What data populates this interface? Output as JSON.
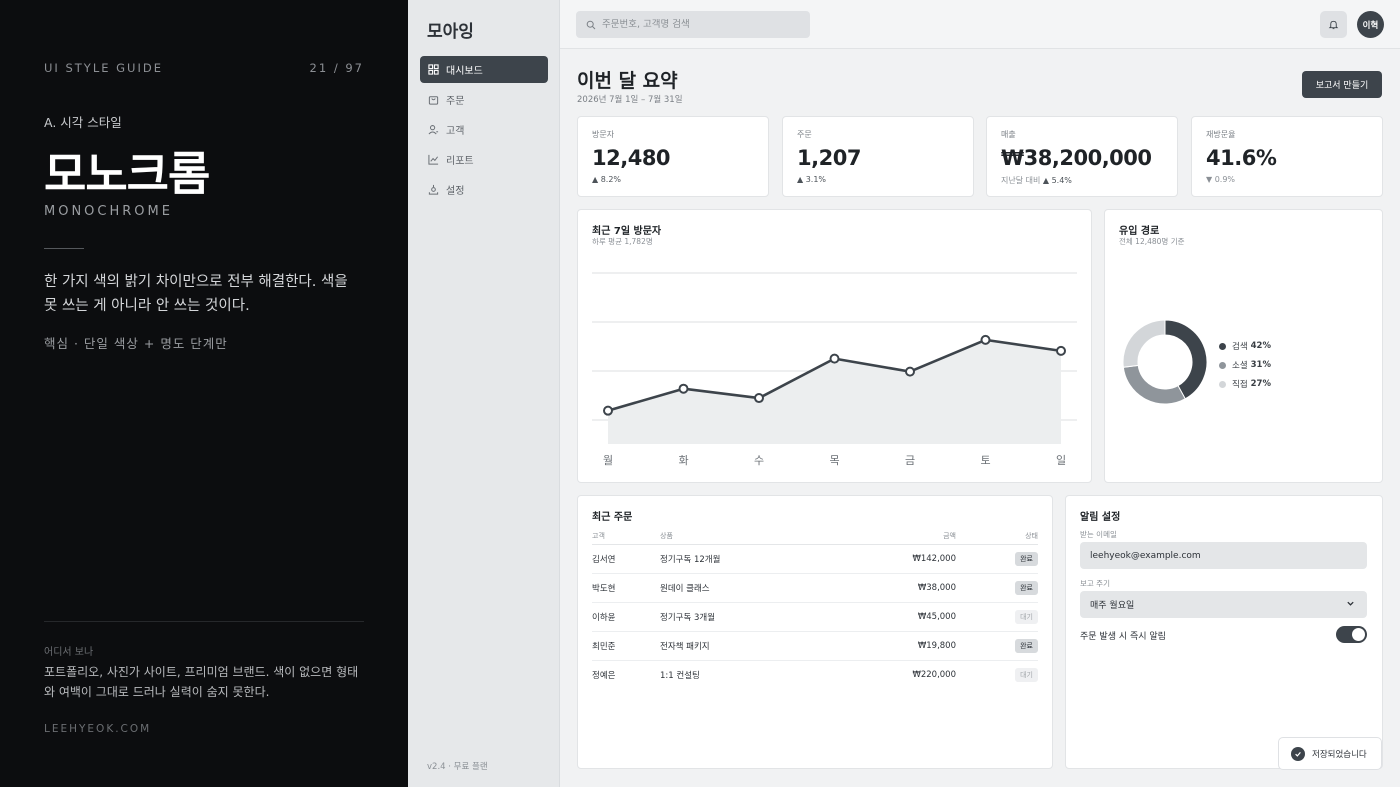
{
  "guide": {
    "kicker": "UI STYLE GUIDE",
    "page": "21 / 97",
    "section": "A. 시각 스타일",
    "title": "모노크롬",
    "title_en": "MONOCHROME",
    "description": "한 가지 색의 밝기 차이만으로 전부 해결한다. 색을 못 쓰는 게 아니라 안 쓰는 것이다.",
    "core": "핵심 · 단일 색상 + 명도 단계만",
    "where_label": "어디서 보나",
    "where_desc": "포트폴리오, 사진가 사이트, 프리미엄 브랜드. 색이 없으면 형태와 여백이 그대로 드러나 실력이 숨지 못한다.",
    "site": "LEEHYEOK.COM"
  },
  "app": {
    "logo": "모아잉",
    "nav": [
      {
        "label": "대시보드",
        "icon": "grid-icon",
        "active": true
      },
      {
        "label": "주문",
        "icon": "bag-icon",
        "active": false
      },
      {
        "label": "고객",
        "icon": "user-icon",
        "active": false
      },
      {
        "label": "리포트",
        "icon": "chart-icon",
        "active": false
      },
      {
        "label": "설정",
        "icon": "gear-icon",
        "active": false
      }
    ],
    "version": "v2.4 · 무료 플랜",
    "search_placeholder": "주문번호, 고객명 검색",
    "avatar": "이혁"
  },
  "main": {
    "title": "이번 달 요약",
    "date_range": "2026년 7월 1일 – 7월 31일",
    "report_button": "보고서 만들기"
  },
  "kpis": [
    {
      "label": "방문자",
      "value": "12,480",
      "prefix": "",
      "change": "▲ 8.2%"
    },
    {
      "label": "주문",
      "value": "1,207",
      "prefix": "",
      "change": "▲ 3.1%"
    },
    {
      "label": "매출",
      "value": "₩38,200,000",
      "prefix": "지난달 대비",
      "change": "▲ 5.4%"
    },
    {
      "label": "재방문율",
      "value": "41.6%",
      "prefix": "",
      "change": "▼ 0.9%"
    }
  ],
  "visitors_card": {
    "title": "최근 7일 방문자",
    "subtitle": "하루 평균 1,782명"
  },
  "chart_data": [
    {
      "type": "area",
      "categories": [
        "월",
        "화",
        "수",
        "목",
        "금",
        "토",
        "일"
      ],
      "values": [
        1410,
        1680,
        1565,
        2050,
        1890,
        2280,
        2145
      ],
      "ylim": [
        1000,
        2500
      ],
      "grid": true,
      "title": "최근 7일 방문자"
    },
    {
      "type": "pie",
      "categories": [
        "검색",
        "소셜",
        "직접"
      ],
      "values": [
        42,
        31,
        27
      ],
      "colors": [
        "#3d444b",
        "#8f959b",
        "#d3d6d9"
      ],
      "title": "유입 경로"
    }
  ],
  "traffic_card": {
    "title": "유입 경로",
    "subtitle": "전체 12,480명 기준",
    "legend": [
      {
        "name": "검색",
        "pct": "42%",
        "color": "#3d444b"
      },
      {
        "name": "소셜",
        "pct": "31%",
        "color": "#8f959b"
      },
      {
        "name": "직접",
        "pct": "27%",
        "color": "#d3d6d9"
      }
    ]
  },
  "orders": {
    "title": "최근 주문",
    "columns": [
      "고객",
      "상품",
      "금액",
      "상태"
    ],
    "rows": [
      {
        "customer": "김서연",
        "product": "정기구독 12개월",
        "amount": "₩142,000",
        "status": "완료",
        "done": true
      },
      {
        "customer": "박도현",
        "product": "원데이 클래스",
        "amount": "₩38,000",
        "status": "완료",
        "done": true
      },
      {
        "customer": "이하윤",
        "product": "정기구독 3개월",
        "amount": "₩45,000",
        "status": "대기",
        "done": false
      },
      {
        "customer": "최민준",
        "product": "전자책 패키지",
        "amount": "₩19,800",
        "status": "완료",
        "done": true
      },
      {
        "customer": "정예은",
        "product": "1:1 컨설팅",
        "amount": "₩220,000",
        "status": "대기",
        "done": false
      }
    ]
  },
  "alerts": {
    "title": "알림 설정",
    "email_label": "받는 이메일",
    "email_value": "leehyeok@example.com",
    "cycle_label": "보고 주기",
    "cycle_value": "매주 월요일",
    "toggle_label": "주문 발생 시 즉시 알림",
    "toggle_on": true
  },
  "toast": {
    "text": "저장되었습니다"
  }
}
